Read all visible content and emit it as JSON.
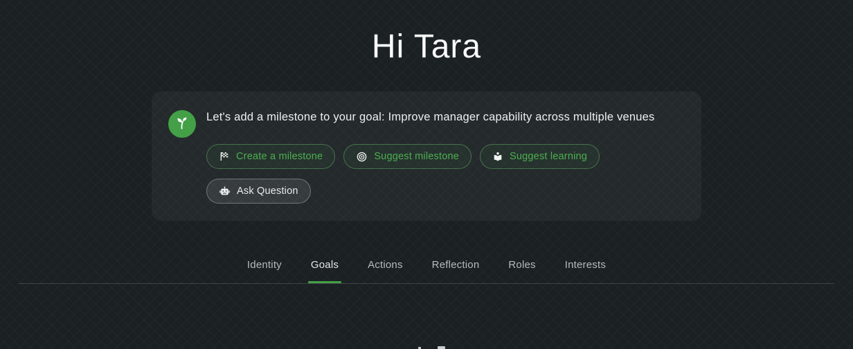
{
  "page": {
    "greeting": "Hi Tara"
  },
  "assistant_card": {
    "icon": "sprout-icon",
    "message": "Let's add a milestone to your goal: Improve manager capability across multiple venues",
    "actions": [
      {
        "label": "Create a milestone",
        "icon": "checkered-flag-icon",
        "style": "green"
      },
      {
        "label": "Suggest milestone",
        "icon": "target-icon",
        "style": "green"
      },
      {
        "label": "Suggest learning",
        "icon": "reader-icon",
        "style": "green"
      },
      {
        "label": "Ask Question",
        "icon": "robot-icon",
        "style": "neutral"
      }
    ]
  },
  "tabs": {
    "items": [
      {
        "label": "Identity",
        "active": false
      },
      {
        "label": "Goals",
        "active": true
      },
      {
        "label": "Actions",
        "active": false
      },
      {
        "label": "Reflection",
        "active": false
      },
      {
        "label": "Roles",
        "active": false
      },
      {
        "label": "Interests",
        "active": false
      }
    ]
  },
  "colors": {
    "background": "#1b2023",
    "card_background": "rgba(255,255,255,0.045)",
    "accent_green": "#43a047",
    "button_text_green": "#4caf50",
    "tab_inactive_text": "#b7bbbc",
    "tab_active_text": "#e5e7e7"
  }
}
